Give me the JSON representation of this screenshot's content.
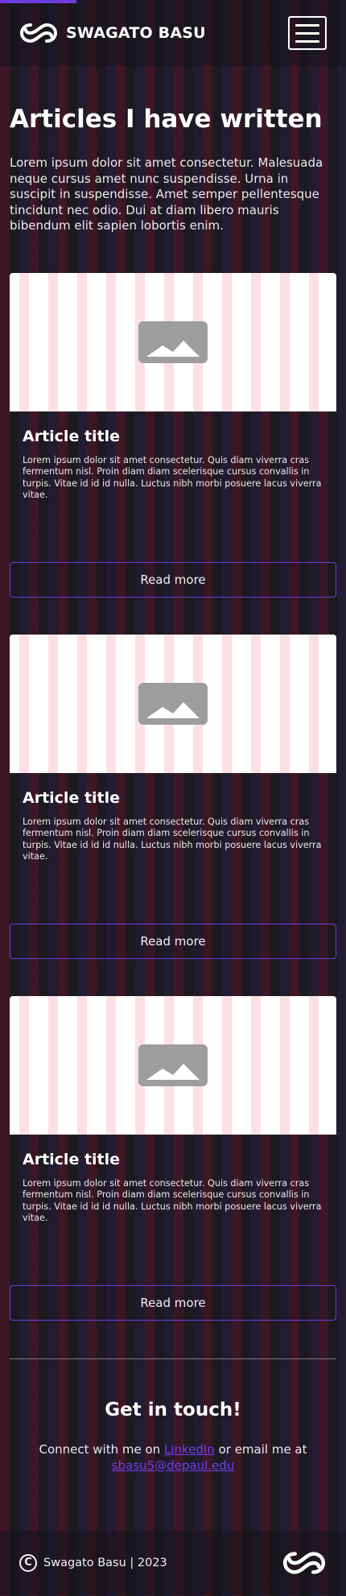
{
  "header": {
    "brand_name": "SWAGATO BASU",
    "scroll_progress": 0.22
  },
  "intro": {
    "title": "Articles I have written",
    "description": "Lorem ipsum dolor sit amet consectetur. Malesuada neque cursus amet nunc suspendisse. Urna in suscipit in suspendisse. Amet semper pellentesque tincidunt nec odio. Dui at diam libero mauris bibendum elit sapien lobortis enim."
  },
  "articles": [
    {
      "title": "Article title",
      "text": "Lorem ipsum dolor sit amet consectetur. Quis diam viverra cras fermentum nisl. Proin diam diam scelerisque cursus convallis in turpis. Vitae id id id nulla. Luctus nibh morbi posuere lacus viverra vitae.",
      "button": "Read more"
    },
    {
      "title": "Article title",
      "text": "Lorem ipsum dolor sit amet consectetur. Quis diam viverra cras fermentum nisl. Proin diam diam scelerisque cursus convallis in turpis. Vitae id id id nulla. Luctus nibh morbi posuere lacus viverra vitae.",
      "button": "Read more"
    },
    {
      "title": "Article title",
      "text": "Lorem ipsum dolor sit amet consectetur. Quis diam viverra cras fermentum nisl. Proin diam diam scelerisque cursus convallis in turpis. Vitae id id id nulla. Luctus nibh morbi posuere lacus viverra vitae.",
      "button": "Read more"
    }
  ],
  "contact": {
    "title": "Get in touch!",
    "text_before_link": "Connect with me on ",
    "linkedin_label": "LinkedIn",
    "text_middle": " or email me at",
    "email": "sbasu5@depaul.edu"
  },
  "footer": {
    "copyright_symbol": "C",
    "copyright_text": "Swagato Basu | 2023"
  },
  "icons": {
    "logo": "infinity-logo-icon",
    "menu": "hamburger-menu-icon",
    "image_placeholder": "image-placeholder-icon",
    "copyright": "copyright-icon"
  },
  "colors": {
    "accent": "#6b3ce0",
    "link": "#6d3fe8",
    "button_border": "#6d3bdc",
    "background": "#1c1a21"
  }
}
